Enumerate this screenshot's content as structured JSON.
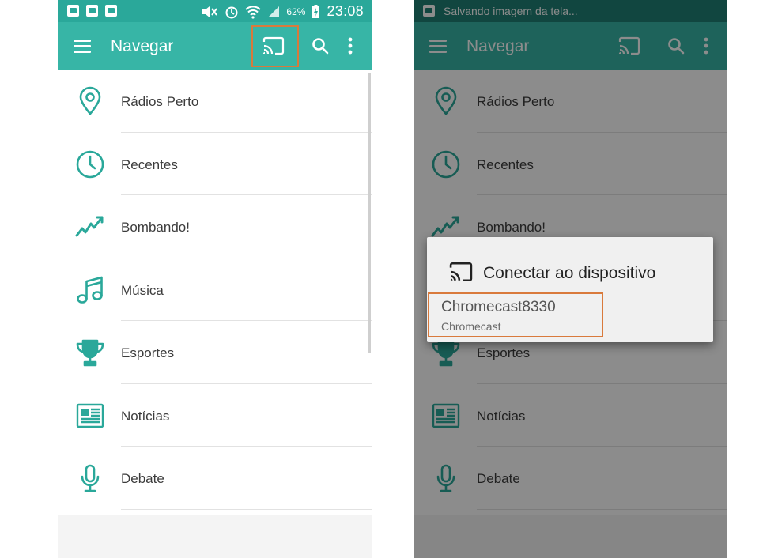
{
  "status_bar": {
    "battery": "62%",
    "time": "23:08"
  },
  "notification": {
    "text": "Salvando imagem da tela..."
  },
  "toolbar": {
    "title": "Navegar"
  },
  "menu": {
    "items": [
      {
        "label": "Rádios Perto",
        "icon": "location-pin-icon"
      },
      {
        "label": "Recentes",
        "icon": "clock-icon"
      },
      {
        "label": "Bombando!",
        "icon": "trending-icon"
      },
      {
        "label": "Música",
        "icon": "music-note-icon"
      },
      {
        "label": "Esportes",
        "icon": "trophy-icon"
      },
      {
        "label": "Notícias",
        "icon": "newspaper-icon"
      },
      {
        "label": "Debate",
        "icon": "microphone-icon"
      }
    ]
  },
  "dialog": {
    "title": "Conectar ao dispositivo",
    "device_name": "Chromecast8330",
    "device_type": "Chromecast"
  },
  "colors": {
    "accent": "#37b5a6",
    "status": "#2aa89a",
    "highlight": "#d97a3c",
    "icon": "#2aa89a"
  }
}
